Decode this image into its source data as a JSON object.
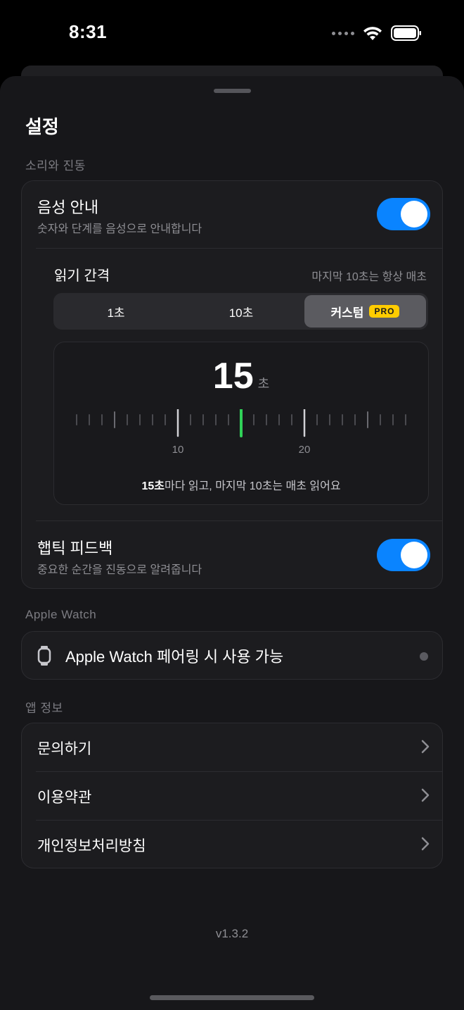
{
  "status": {
    "time": "8:31"
  },
  "sheet": {
    "title": "설정"
  },
  "sound": {
    "section_label": "소리와 진동",
    "voice": {
      "title": "음성 안내",
      "subtitle": "숫자와 단계를 음성으로 안내합니다",
      "on": true
    },
    "interval": {
      "title": "읽기 간격",
      "note": "마지막 10초는 항상 매초",
      "options": [
        "1초",
        "10초",
        "커스텀"
      ],
      "selected": "커스텀",
      "pro_badge": "PRO"
    },
    "picker": {
      "value": "15",
      "unit": "초",
      "ticks": [
        "10",
        "20"
      ],
      "caption_bold": "15초",
      "caption_rest": "마다 읽고, 마지막 10초는 매초 읽어요"
    },
    "haptic": {
      "title": "햅틱 피드백",
      "subtitle": "중요한 순간을 진동으로 알려줍니다",
      "on": true
    }
  },
  "watch": {
    "section_label": "Apple Watch",
    "label": "Apple Watch 페어링 시 사용 가능"
  },
  "app_info": {
    "section_label": "앱 정보",
    "items": [
      "문의하기",
      "이용약관",
      "개인정보처리방침"
    ]
  },
  "version": "v1.3.2",
  "colors": {
    "accent": "#0a84ff",
    "highlight": "#30d158",
    "pro": "#ffcc00"
  }
}
